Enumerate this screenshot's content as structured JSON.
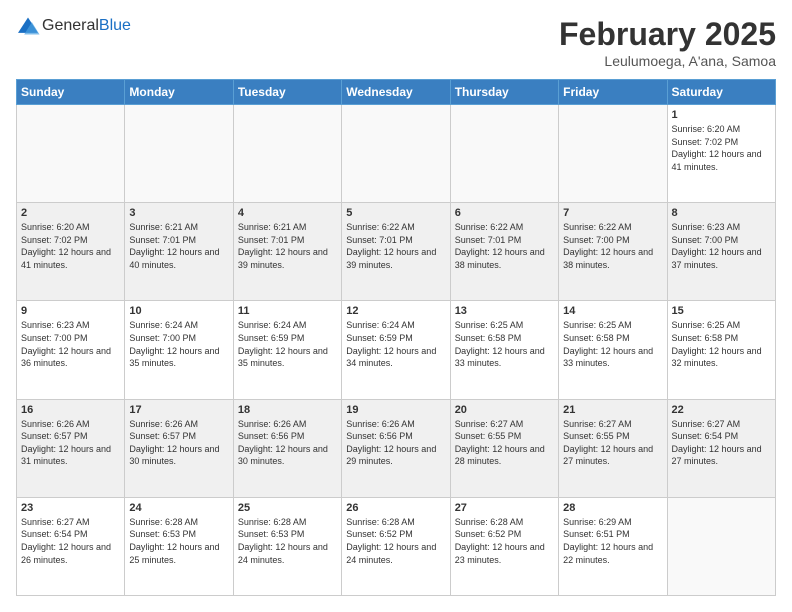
{
  "header": {
    "logo_general": "General",
    "logo_blue": "Blue",
    "month_title": "February 2025",
    "location": "Leulumoega, A'ana, Samoa"
  },
  "weekdays": [
    "Sunday",
    "Monday",
    "Tuesday",
    "Wednesday",
    "Thursday",
    "Friday",
    "Saturday"
  ],
  "weeks": [
    [
      {
        "day": "",
        "info": ""
      },
      {
        "day": "",
        "info": ""
      },
      {
        "day": "",
        "info": ""
      },
      {
        "day": "",
        "info": ""
      },
      {
        "day": "",
        "info": ""
      },
      {
        "day": "",
        "info": ""
      },
      {
        "day": "1",
        "info": "Sunrise: 6:20 AM\nSunset: 7:02 PM\nDaylight: 12 hours\nand 41 minutes."
      }
    ],
    [
      {
        "day": "2",
        "info": "Sunrise: 6:20 AM\nSunset: 7:02 PM\nDaylight: 12 hours\nand 41 minutes."
      },
      {
        "day": "3",
        "info": "Sunrise: 6:21 AM\nSunset: 7:01 PM\nDaylight: 12 hours\nand 40 minutes."
      },
      {
        "day": "4",
        "info": "Sunrise: 6:21 AM\nSunset: 7:01 PM\nDaylight: 12 hours\nand 39 minutes."
      },
      {
        "day": "5",
        "info": "Sunrise: 6:22 AM\nSunset: 7:01 PM\nDaylight: 12 hours\nand 39 minutes."
      },
      {
        "day": "6",
        "info": "Sunrise: 6:22 AM\nSunset: 7:01 PM\nDaylight: 12 hours\nand 38 minutes."
      },
      {
        "day": "7",
        "info": "Sunrise: 6:22 AM\nSunset: 7:00 PM\nDaylight: 12 hours\nand 38 minutes."
      },
      {
        "day": "8",
        "info": "Sunrise: 6:23 AM\nSunset: 7:00 PM\nDaylight: 12 hours\nand 37 minutes."
      }
    ],
    [
      {
        "day": "9",
        "info": "Sunrise: 6:23 AM\nSunset: 7:00 PM\nDaylight: 12 hours\nand 36 minutes."
      },
      {
        "day": "10",
        "info": "Sunrise: 6:24 AM\nSunset: 7:00 PM\nDaylight: 12 hours\nand 35 minutes."
      },
      {
        "day": "11",
        "info": "Sunrise: 6:24 AM\nSunset: 6:59 PM\nDaylight: 12 hours\nand 35 minutes."
      },
      {
        "day": "12",
        "info": "Sunrise: 6:24 AM\nSunset: 6:59 PM\nDaylight: 12 hours\nand 34 minutes."
      },
      {
        "day": "13",
        "info": "Sunrise: 6:25 AM\nSunset: 6:58 PM\nDaylight: 12 hours\nand 33 minutes."
      },
      {
        "day": "14",
        "info": "Sunrise: 6:25 AM\nSunset: 6:58 PM\nDaylight: 12 hours\nand 33 minutes."
      },
      {
        "day": "15",
        "info": "Sunrise: 6:25 AM\nSunset: 6:58 PM\nDaylight: 12 hours\nand 32 minutes."
      }
    ],
    [
      {
        "day": "16",
        "info": "Sunrise: 6:26 AM\nSunset: 6:57 PM\nDaylight: 12 hours\nand 31 minutes."
      },
      {
        "day": "17",
        "info": "Sunrise: 6:26 AM\nSunset: 6:57 PM\nDaylight: 12 hours\nand 30 minutes."
      },
      {
        "day": "18",
        "info": "Sunrise: 6:26 AM\nSunset: 6:56 PM\nDaylight: 12 hours\nand 30 minutes."
      },
      {
        "day": "19",
        "info": "Sunrise: 6:26 AM\nSunset: 6:56 PM\nDaylight: 12 hours\nand 29 minutes."
      },
      {
        "day": "20",
        "info": "Sunrise: 6:27 AM\nSunset: 6:55 PM\nDaylight: 12 hours\nand 28 minutes."
      },
      {
        "day": "21",
        "info": "Sunrise: 6:27 AM\nSunset: 6:55 PM\nDaylight: 12 hours\nand 27 minutes."
      },
      {
        "day": "22",
        "info": "Sunrise: 6:27 AM\nSunset: 6:54 PM\nDaylight: 12 hours\nand 27 minutes."
      }
    ],
    [
      {
        "day": "23",
        "info": "Sunrise: 6:27 AM\nSunset: 6:54 PM\nDaylight: 12 hours\nand 26 minutes."
      },
      {
        "day": "24",
        "info": "Sunrise: 6:28 AM\nSunset: 6:53 PM\nDaylight: 12 hours\nand 25 minutes."
      },
      {
        "day": "25",
        "info": "Sunrise: 6:28 AM\nSunset: 6:53 PM\nDaylight: 12 hours\nand 24 minutes."
      },
      {
        "day": "26",
        "info": "Sunrise: 6:28 AM\nSunset: 6:52 PM\nDaylight: 12 hours\nand 24 minutes."
      },
      {
        "day": "27",
        "info": "Sunrise: 6:28 AM\nSunset: 6:52 PM\nDaylight: 12 hours\nand 23 minutes."
      },
      {
        "day": "28",
        "info": "Sunrise: 6:29 AM\nSunset: 6:51 PM\nDaylight: 12 hours\nand 22 minutes."
      },
      {
        "day": "",
        "info": ""
      }
    ]
  ]
}
